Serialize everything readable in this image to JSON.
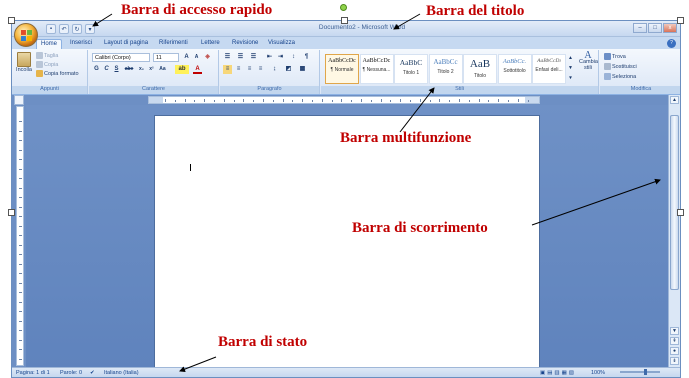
{
  "annotations": {
    "quick_access": "Barra di accesso rapido",
    "title_bar": "Barra del titolo",
    "ribbon": "Barra multifunzione",
    "scrollbar": "Barra di scorrimento",
    "status_bar": "Barra di stato"
  },
  "window": {
    "title": "Documento2 - Microsoft Word",
    "controls": [
      "–",
      "□",
      "x"
    ]
  },
  "tabs": [
    "Home",
    "Inserisci",
    "Layout di pagina",
    "Riferimenti",
    "Lettere",
    "Revisione",
    "Visualizza"
  ],
  "active_tab": "Home",
  "clipboard": {
    "paste": "Incolla",
    "cut": "Taglia",
    "copy": "Copia",
    "format_painter": "Copia formato",
    "label": "Appunti"
  },
  "font": {
    "name": "Calibri (Corpo)",
    "size": "11",
    "label": "Carattere",
    "buttons": [
      "G",
      "C",
      "S",
      "abe",
      "x₂",
      "x²",
      "Aa"
    ]
  },
  "paragraph": {
    "label": "Paragrafo"
  },
  "styles": {
    "label": "Stili",
    "items": [
      {
        "sample": "AaBbCcDc",
        "name": "¶ Normale"
      },
      {
        "sample": "AaBbCcDc",
        "name": "¶ Nessuna..."
      },
      {
        "sample": "AaBbC",
        "name": "Titolo 1"
      },
      {
        "sample": "AaBbCc",
        "name": "Titolo 2"
      },
      {
        "sample": "AaB",
        "name": "Titolo"
      },
      {
        "sample": "AaBbCc.",
        "name": "Sottotitolo"
      },
      {
        "sample": "AaBbCcDı",
        "name": "Enfasi deli..."
      }
    ],
    "change": "Cambia stili"
  },
  "editing": {
    "find": "Trova",
    "replace": "Sostituisci",
    "select": "Seleziona",
    "label": "Modifica"
  },
  "status": {
    "page": "Pagina: 1 di 1",
    "words": "Parole: 0",
    "language": "Italiano (Italia)",
    "zoom": "100%"
  },
  "colors": {
    "annotation": "#c00000",
    "workspace": "#6f91c6",
    "ribbon": "#dbe6f6"
  }
}
